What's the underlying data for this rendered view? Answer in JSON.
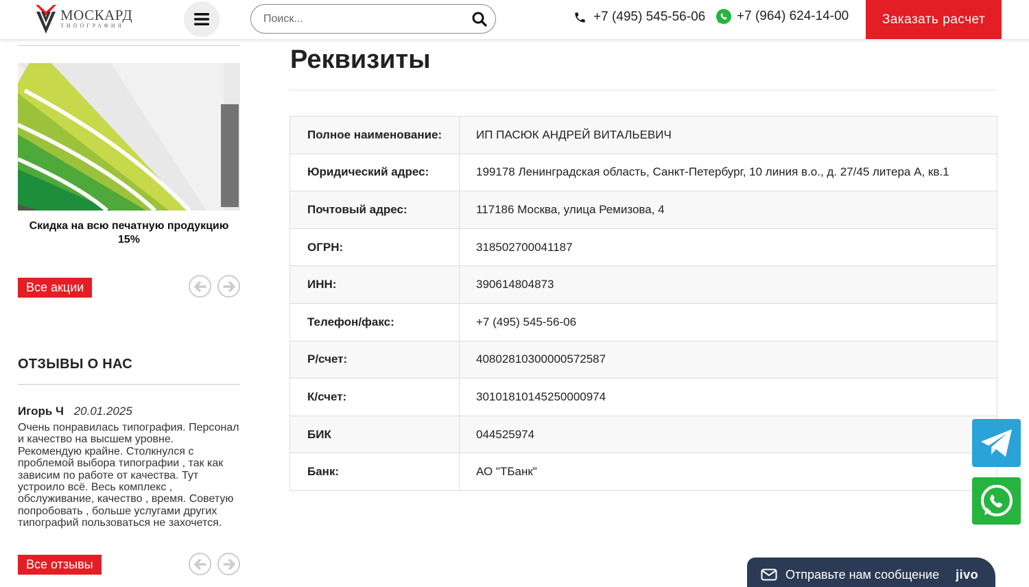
{
  "header": {
    "logo_name": "МОСКАРД",
    "logo_sub": "ТИПОГРАФИЯ",
    "search_placeholder": "Поиск...",
    "phone1": "+7 (495) 545-56-06",
    "phone2": "+7 (964) 624-14-00",
    "order_label": "Заказать расчет"
  },
  "sidebar": {
    "promo_title": "Скидка на всю печатную продукцию 15%",
    "promo_all_label": "Все акции",
    "reviews_title": "ОТЗЫВЫ О НАС",
    "review": {
      "author": "Игорь Ч",
      "date": "20.01.2025",
      "text": "Очень понравилась типография. Персонал и качество на высшем уровне. Рекомендую крайне. Столкнулся с проблемой выбора типографии , так как зависим по работе от качества. Тут устроило всё. Весь комплекс , обслуживание, качество , время. Советую попробовать , больше услугами других типографий пользоваться не захочется."
    },
    "reviews_all_label": "Все отзывы"
  },
  "main": {
    "title": "Реквизиты",
    "rows": [
      {
        "key": "Полное наименование:",
        "value": "ИП ПАСЮК АНДРЕЙ ВИТАЛЬЕВИЧ"
      },
      {
        "key": "Юридический адрес:",
        "value": "199178 Ленинградская область, Санкт-Петербург, 10 линия в.о., д. 27/45 литера А, кв.1"
      },
      {
        "key": "Почтовый адрес:",
        "value": "117186 Москва, улица Ремизова, 4"
      },
      {
        "key": "ОГРН:",
        "value": "318502700041187"
      },
      {
        "key": "ИНН:",
        "value": "390614804873"
      },
      {
        "key": "Телефон/факс:",
        "value": "+7 (495) 545-56-06"
      },
      {
        "key": "Р/счет:",
        "value": "40802810300000572587"
      },
      {
        "key": "К/счет:",
        "value": "30101810145250000974"
      },
      {
        "key": "БИК",
        "value": "044525974"
      },
      {
        "key": "Банк:",
        "value": "АО \"ТБанк\""
      }
    ]
  },
  "chat": {
    "label": "Отправьте нам сообщение",
    "brand": "jivo"
  },
  "colors": {
    "accent": "#e31e24",
    "telegram": "#2aa3d8",
    "whatsapp": "#27b43e",
    "chat_bg": "#2b3a55"
  }
}
